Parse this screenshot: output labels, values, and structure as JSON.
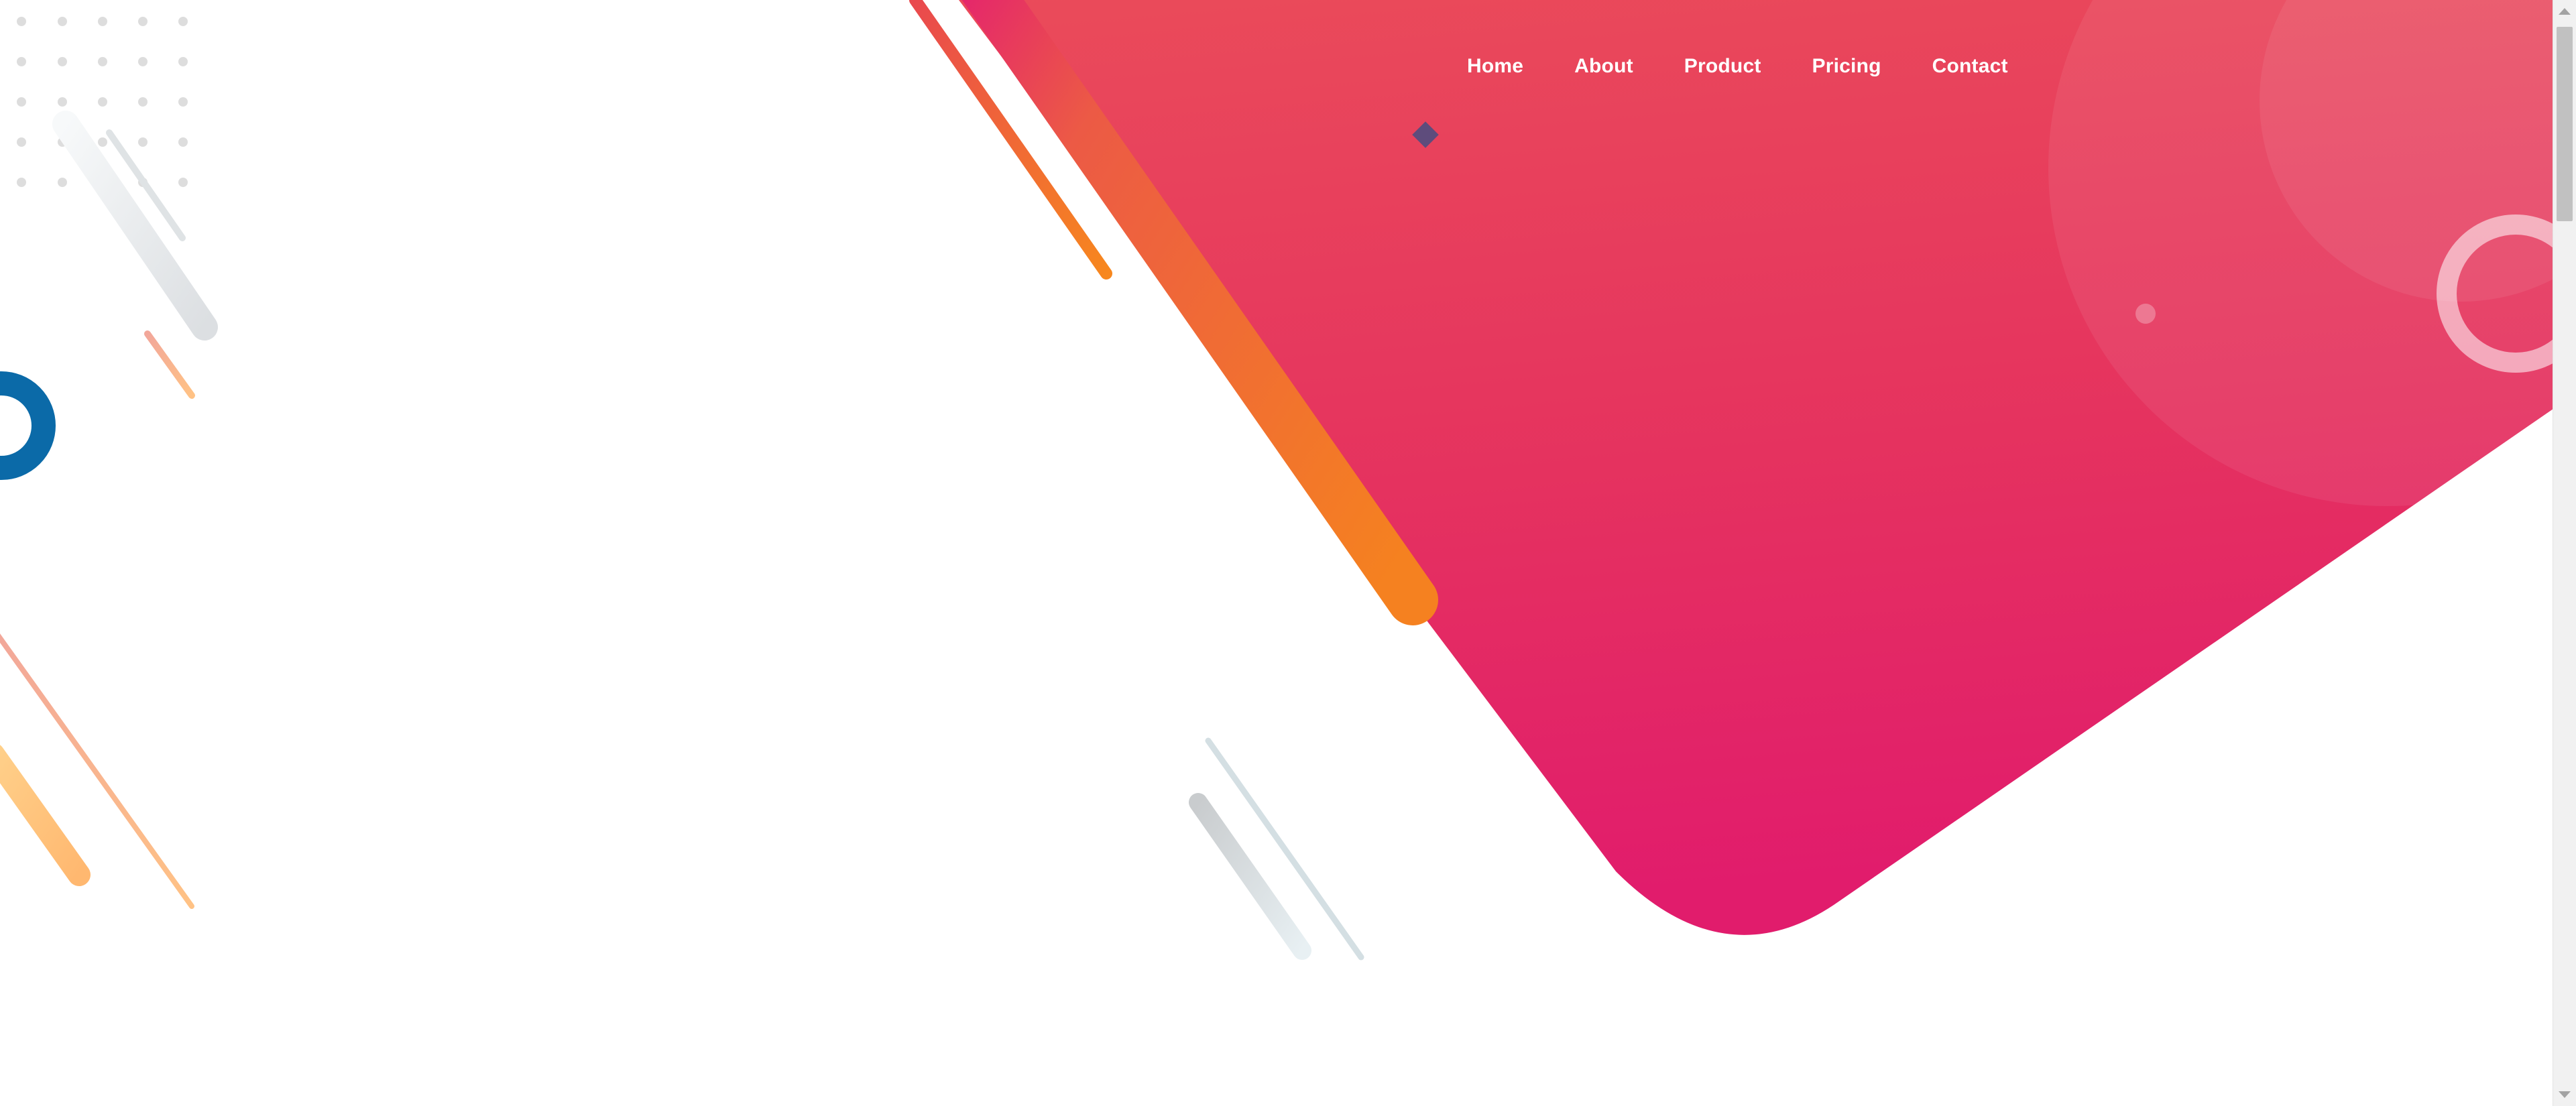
{
  "nav": {
    "items": [
      {
        "label": "Home"
      },
      {
        "label": "About"
      },
      {
        "label": "Product"
      },
      {
        "label": "Pricing"
      },
      {
        "label": "Contact"
      }
    ]
  },
  "colors": {
    "hero_top": "#ea4b5a",
    "hero_bottom": "#e11c6c",
    "accent_orange": "#f57c20",
    "accent_blue": "#0b6aa8",
    "accent_peach": "#ffc27a",
    "diamond": "#5e4c7c",
    "page_background": "#ffffff"
  }
}
